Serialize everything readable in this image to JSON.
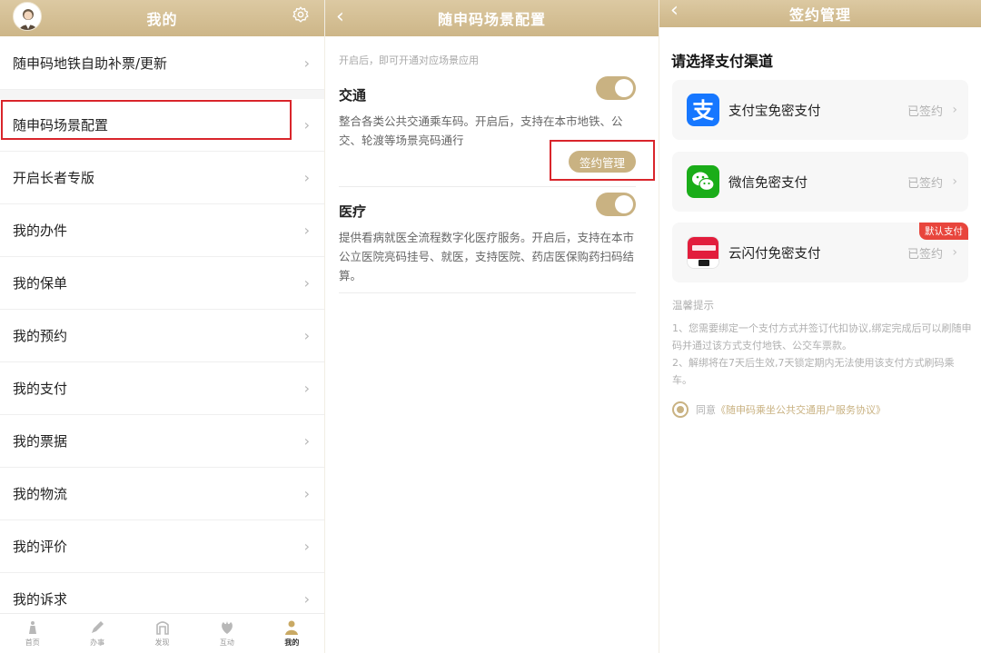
{
  "colors": {
    "gold": "#c9b282",
    "header": "#d5bf95",
    "highlight": "#d9252b"
  },
  "panel1": {
    "title": "我的",
    "menu": [
      "随申码地铁自助补票/更新",
      "随申码场景配置",
      "开启长者专版",
      "我的办件",
      "我的保单",
      "我的预约",
      "我的支付",
      "我的票据",
      "我的物流",
      "我的评价",
      "我的诉求"
    ],
    "chevron": "›",
    "tabs": [
      {
        "label": "首页",
        "icon": "home-icon"
      },
      {
        "label": "办事",
        "icon": "pen-icon"
      },
      {
        "label": "发现",
        "icon": "discover-icon"
      },
      {
        "label": "互动",
        "icon": "interact-icon"
      },
      {
        "label": "我的",
        "icon": "user-icon",
        "active": true
      }
    ]
  },
  "panel2": {
    "title": "随申码场景配置",
    "hint": "开启后，即可开通对应场景应用",
    "scenes": [
      {
        "title": "交通",
        "desc": "整合各类公共交通乘车码。开启后，支持在本市地铁、公交、轮渡等场景亮码通行",
        "enabled": true
      },
      {
        "title": "医疗",
        "desc": "提供看病就医全流程数字化医疗服务。开启后，支持在本市公立医院亮码挂号、就医，支持医院、药店医保购药扫码结算。",
        "enabled": true
      }
    ],
    "sign_button": "签约管理"
  },
  "panel3": {
    "title": "签约管理",
    "heading": "请选择支付渠道",
    "channels": [
      {
        "name": "支付宝免密支付",
        "status": "已签约",
        "icon": "alipay-icon"
      },
      {
        "name": "微信免密支付",
        "status": "已签约",
        "icon": "wechat-icon"
      },
      {
        "name": "云闪付免密支付",
        "status": "已签约",
        "icon": "unionpay-icon",
        "badge": "默认支付"
      }
    ],
    "tips_title": "温馨提示",
    "tips": [
      "1、您需要绑定一个支付方式并签订代扣协议,绑定完成后可以刷随申码并通过该方式支付地铁、公交车票款。",
      "2、解绑将在7天后生效,7天锁定期内无法使用该支付方式刷码乘车。"
    ],
    "agree_prefix": "同意",
    "agree_link": "《随申码乘坐公共交通用户服务协议》"
  }
}
